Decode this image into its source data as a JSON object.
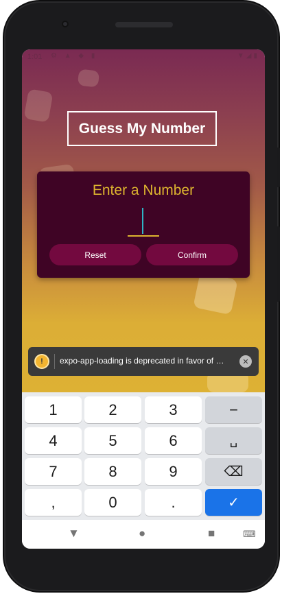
{
  "status_bar": {
    "time": "1:01",
    "left_icons": "⚙ ▲ ◆ ▮",
    "right_icons": "▼◢▮"
  },
  "app": {
    "title": "Guess My Number",
    "card": {
      "heading": "Enter a Number",
      "input_value": "",
      "reset_label": "Reset",
      "confirm_label": "Confirm"
    }
  },
  "toast": {
    "warning_icon": "warning-icon",
    "warning_glyph": "!",
    "message": "expo-app-loading is deprecated in favor of …",
    "close_glyph": "✕"
  },
  "keyboard": {
    "rows": [
      [
        "1",
        "2",
        "3",
        "−"
      ],
      [
        "4",
        "5",
        "6",
        "␣"
      ],
      [
        "7",
        "8",
        "9",
        "⌫"
      ],
      [
        ",",
        "0",
        ".",
        "✓"
      ]
    ]
  },
  "navbar": {
    "back": "▼",
    "home": "●",
    "recents": "■",
    "keyboard_switch": "⌨"
  },
  "colors": {
    "card": "#3f0425",
    "accent": "#ddb52f",
    "button": "#73093f",
    "confirm_key": "#1a73e8"
  }
}
